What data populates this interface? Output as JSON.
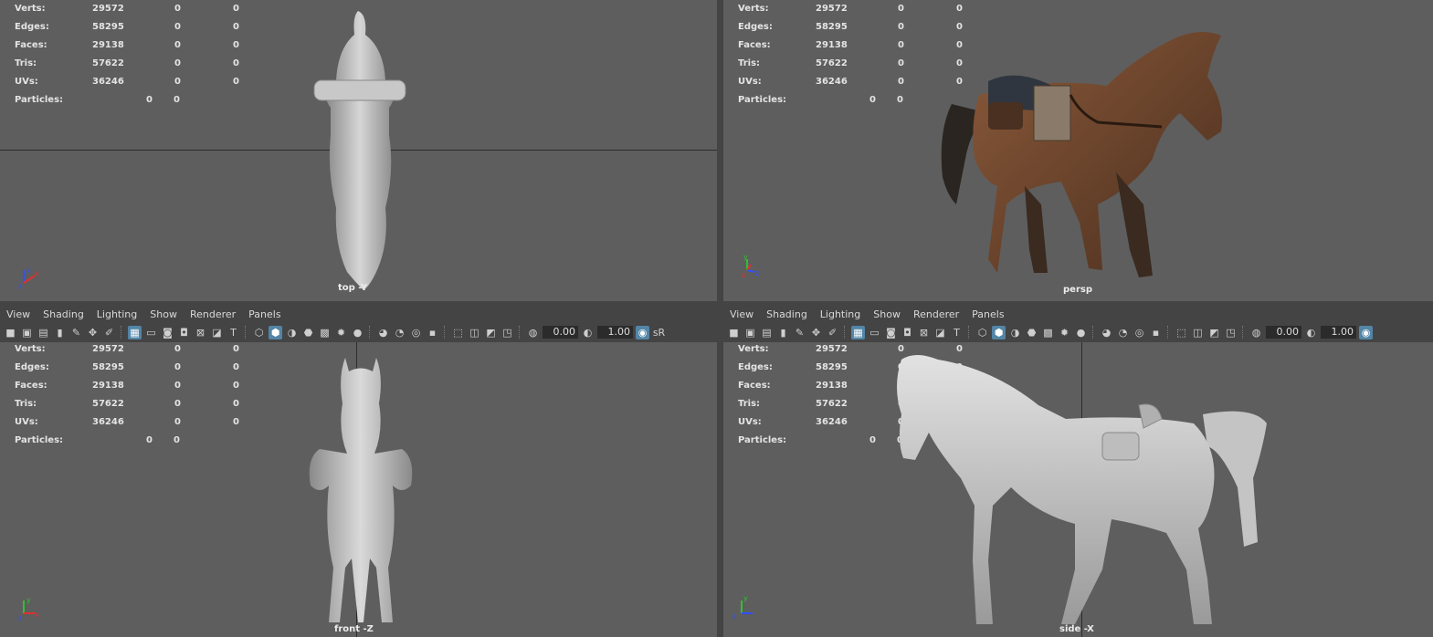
{
  "menus": [
    "View",
    "Shading",
    "Lighting",
    "Show",
    "Renderer",
    "Panels"
  ],
  "toolbar": {
    "exposure": "0.00",
    "gamma": "1.00",
    "color_space_label": "sR"
  },
  "hud": {
    "labels": {
      "verts": "Verts:",
      "edges": "Edges:",
      "faces": "Faces:",
      "tris": "Tris:",
      "uvs": "UVs:",
      "particles": "Particles:"
    },
    "values": {
      "verts": [
        "29572",
        "0",
        "0"
      ],
      "edges": [
        "58295",
        "0",
        "0"
      ],
      "faces": [
        "29138",
        "0",
        "0"
      ],
      "tris": [
        "57622",
        "0",
        "0"
      ],
      "uvs": [
        "36246",
        "0",
        "0"
      ],
      "particles": [
        "0",
        "0"
      ]
    }
  },
  "viewports": {
    "top": {
      "camera": "top -Y",
      "axis_labels": [
        "y",
        "z",
        "x"
      ]
    },
    "persp": {
      "camera": "persp",
      "axis_labels": [
        "y",
        "z",
        "x"
      ]
    },
    "front": {
      "camera": "front -Z",
      "axis_labels": [
        "y",
        "z",
        "x"
      ]
    },
    "side": {
      "camera": "side -X",
      "axis_labels": [
        "y",
        "z"
      ]
    }
  },
  "colors": {
    "viewport_bg": "#5e5e5e",
    "panel_bg": "#444444",
    "accent": "#5285a6",
    "axis_x": "#e03030",
    "axis_y": "#30c030",
    "axis_z": "#3050ff"
  }
}
